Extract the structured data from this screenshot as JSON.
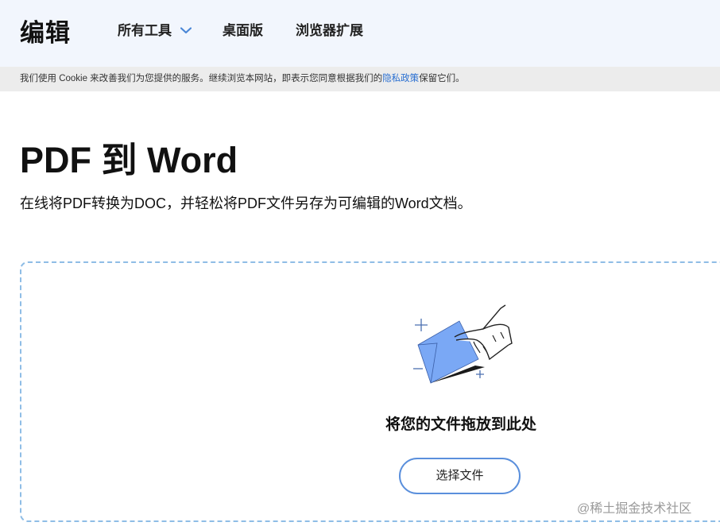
{
  "header": {
    "logo": "编辑",
    "nav": [
      {
        "label": "所有工具",
        "icon": "chevron-down-icon"
      },
      {
        "label": "桌面版"
      },
      {
        "label": "浏览器扩展"
      }
    ]
  },
  "cookie_banner": {
    "text_before": "我们使用 Cookie 来改善我们为您提供的服务。继续浏览本网站，即表示您同意根据我们的",
    "link": "隐私政策",
    "text_after": "保留它们。"
  },
  "main": {
    "title": "PDF 到 Word",
    "subtitle": "在线将PDF转换为DOC，并轻松将PDF文件另存为可编辑的Word文档。"
  },
  "dropzone": {
    "illustration_icon": "hand-drop-file-icon",
    "drop_text": "将您的文件拖放到此处",
    "button_label": "选择文件"
  },
  "watermark": "@稀土掘金技术社区",
  "colors": {
    "header_bg": "#f2f6fd",
    "cookie_bg": "#ececec",
    "accent": "#5a8fdc",
    "dropzone_border": "#8fbde6",
    "file_icon": "#7aa8f5"
  }
}
